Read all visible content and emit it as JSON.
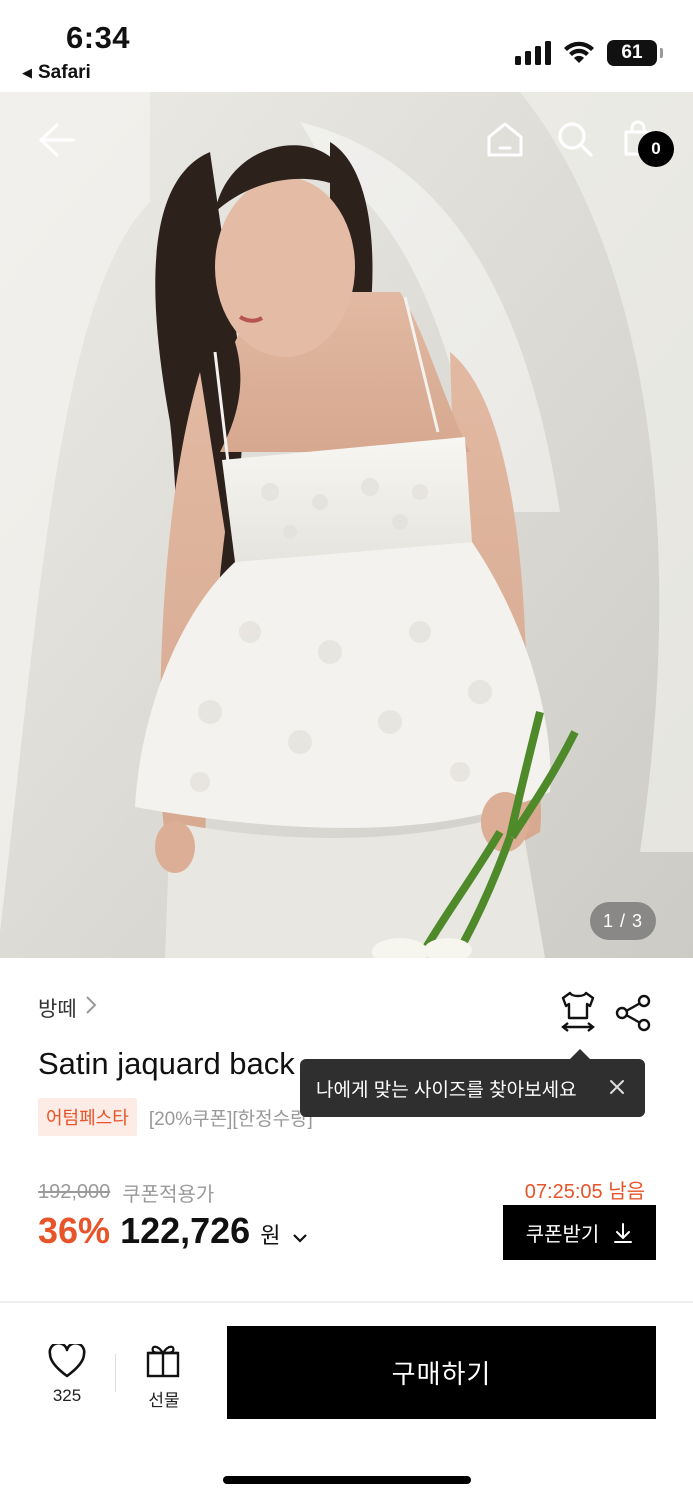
{
  "status_bar": {
    "time": "6:34",
    "back_app": "Safari",
    "battery": "61"
  },
  "hero": {
    "counter": "1 / 3",
    "cart_count": "0"
  },
  "product": {
    "brand": "방떼",
    "title": "Satin jaquard back",
    "festa_badge": "어텀페스타",
    "tags": "[20%쿠폰][한정수량]",
    "original_price": "192,000",
    "coupon_label": "쿠폰적용가",
    "timer": "07:25:05 남음",
    "discount": "36%",
    "price": "122,726",
    "currency": "원",
    "coupon_button": "쿠폰받기"
  },
  "tooltip": {
    "text": "나에게 맞는 사이즈를 찾아보세요"
  },
  "bottom_bar": {
    "like_count": "325",
    "gift_label": "선물",
    "buy_label": "구매하기"
  },
  "colors": {
    "accent": "#e8542a",
    "primary": "#000000"
  }
}
